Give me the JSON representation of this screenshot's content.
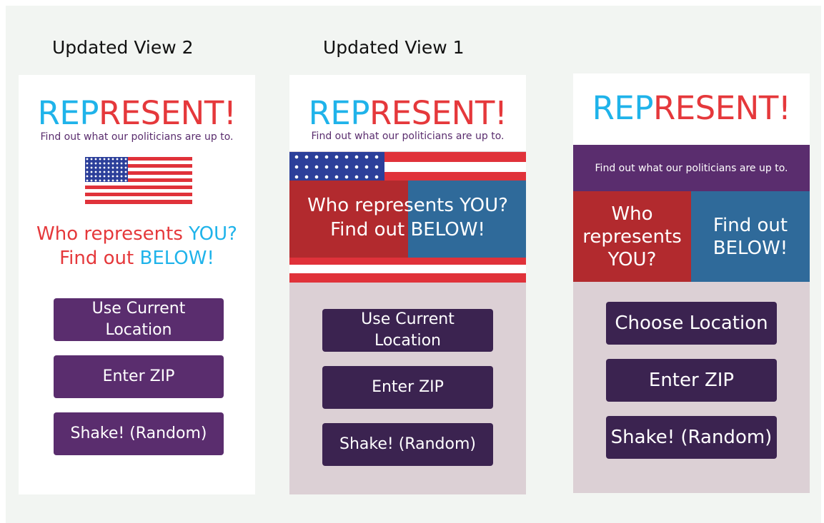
{
  "labels": {
    "updated_view_2": "Updated View 2",
    "updated_view_1": "Updated View 1"
  },
  "colors": {
    "title_blue": "#1fb3ea",
    "title_red": "#e5383b",
    "tagline_purple": "#5a2d6e",
    "button_purple_light": "#5a2d6e",
    "button_purple_dark": "#3b2350",
    "panel_red": "#b22a2e",
    "panel_blue": "#2f6a9a",
    "lower_panel": "#dcd0d5",
    "banner_purple": "#5a2d6e",
    "flag_red": "#e0323a",
    "flag_blue": "#2c3f9a"
  },
  "view2": {
    "title_part1": "REP",
    "title_part2": "RESENT!",
    "tagline": "Find out what our politicians are up to.",
    "prompt_line1_a": "Who represents ",
    "prompt_line1_b": "YOU?",
    "prompt_line2_a": "Find out ",
    "prompt_line2_b": "BELOW!",
    "buttons": {
      "location_line1": "Use Current",
      "location_line2": "Location",
      "zip": "Enter ZIP",
      "shake": "Shake! (Random)"
    }
  },
  "view1": {
    "title_part1": "REP",
    "title_part2": "RESENT!",
    "tagline": "Find out what our politicians are up to.",
    "prompt_line1": "Who represents YOU?",
    "prompt_line2": "Find out BELOW!",
    "buttons": {
      "location_line1": "Use Current",
      "location_line2": "Location",
      "zip": "Enter ZIP",
      "shake": "Shake! (Random)"
    }
  },
  "view3": {
    "title_part1": "REP",
    "title_part2": "RESENT!",
    "tagline": "Find out what our politicians are up to.",
    "left_panel_line1": "Who",
    "left_panel_line2": "represents",
    "left_panel_line3": "YOU?",
    "right_panel_line1": "Find out",
    "right_panel_line2": "BELOW!",
    "buttons": {
      "location": "Choose Location",
      "zip": "Enter ZIP",
      "shake": "Shake! (Random)"
    }
  }
}
